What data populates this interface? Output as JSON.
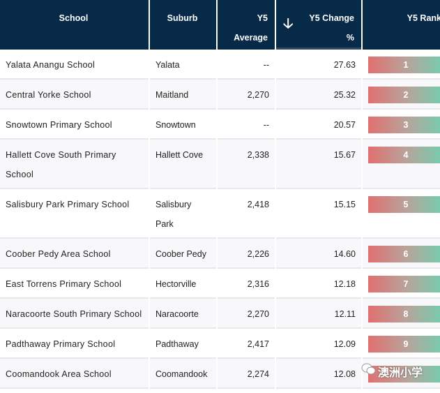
{
  "header": {
    "school": "School",
    "suburb": "Suburb",
    "y5_average": [
      "Y5",
      "Average"
    ],
    "y5_change": [
      "Y5 Change",
      "%"
    ],
    "y5_rank": "Y5 Rank",
    "sort_icon": "arrow-down-icon"
  },
  "colors": {
    "header_bg": "#062a47",
    "bar_low": "#e07070",
    "bar_high": "#74ceae"
  },
  "rows": [
    {
      "school": "Yalata Anangu School",
      "suburb": "Yalata",
      "average": "--",
      "change": "27.63",
      "rank": "1"
    },
    {
      "school": "Central Yorke School",
      "suburb": "Maitland",
      "average": "2,270",
      "change": "25.32",
      "rank": "2"
    },
    {
      "school": "Snowtown Primary School",
      "suburb": "Snowtown",
      "average": "--",
      "change": "20.57",
      "rank": "3"
    },
    {
      "school": "Hallett Cove South Primary School",
      "suburb": "Hallett Cove",
      "average": "2,338",
      "change": "15.67",
      "rank": "4"
    },
    {
      "school": "Salisbury Park Primary School",
      "suburb": "Salisbury Park",
      "average": "2,418",
      "change": "15.15",
      "rank": "5"
    },
    {
      "school": "Coober Pedy Area School",
      "suburb": "Coober Pedy",
      "average": "2,226",
      "change": "14.60",
      "rank": "6"
    },
    {
      "school": "East Torrens Primary School",
      "suburb": "Hectorville",
      "average": "2,316",
      "change": "12.18",
      "rank": "7"
    },
    {
      "school": "Naracoorte South Primary School",
      "suburb": "Naracoorte",
      "average": "2,270",
      "change": "12.11",
      "rank": "8"
    },
    {
      "school": "Padthaway Primary School",
      "suburb": "Padthaway",
      "average": "2,417",
      "change": "12.09",
      "rank": "9"
    },
    {
      "school": "Coomandook Area School",
      "suburb": "Coomandook",
      "average": "2,274",
      "change": "12.08",
      "rank": ""
    }
  ],
  "watermark": "澳洲小学"
}
